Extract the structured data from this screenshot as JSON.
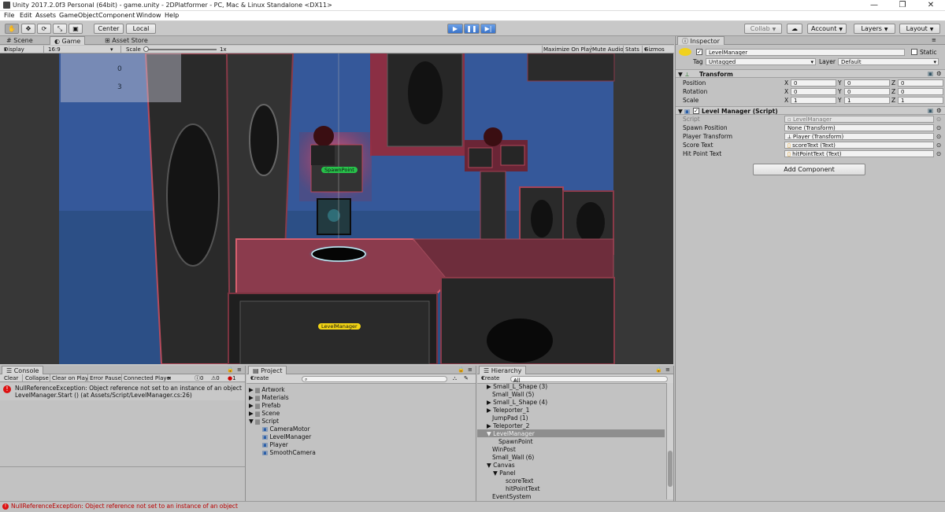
{
  "window": {
    "title": "Unity 2017.2.0f3 Personal (64bit) - game.unity - 2DPlatformer - PC, Mac & Linux Standalone <DX11>",
    "minimize": "—",
    "maximize": "❐",
    "close": "✕"
  },
  "menu": [
    "File",
    "Edit",
    "Assets",
    "GameObject",
    "Component",
    "Window",
    "Help"
  ],
  "toolbar": {
    "tools": [
      "✋",
      "✥",
      "⟳",
      "⤡",
      "▣"
    ],
    "pivot": "Center",
    "space": "Local",
    "play": "▶",
    "pause": "❚❚",
    "step": "▶|",
    "collab": "Collab",
    "account": "Account",
    "layers": "Layers",
    "layout": "Layout"
  },
  "scene_tabs": [
    "Scene",
    "Game",
    "Asset Store"
  ],
  "game_bar": {
    "display": "Display 1",
    "aspect": "16:9",
    "scale_label": "Scale",
    "scale_value": "1x",
    "maximize": "Maximize On Play",
    "mute": "Mute Audio",
    "stats": "Stats",
    "gizmos": "Gizmos"
  },
  "hud": {
    "score": "0",
    "hit_points": "3"
  },
  "scene_labels": {
    "spawn": "SpawnPoint",
    "level": "LevelManager"
  },
  "inspector": {
    "tab": "Inspector",
    "object_name": "LevelManager",
    "static_label": "Static",
    "tag_label": "Tag",
    "tag_value": "Untagged",
    "layer_label": "Layer",
    "layer_value": "Default",
    "transform": {
      "title": "Transform",
      "rows": [
        {
          "label": "Position",
          "x": "0",
          "y": "0",
          "z": "0"
        },
        {
          "label": "Rotation",
          "x": "0",
          "y": "0",
          "z": "0"
        },
        {
          "label": "Scale",
          "x": "1",
          "y": "1",
          "z": "1"
        }
      ]
    },
    "script_comp": {
      "title": "Level Manager (Script)",
      "fields": [
        {
          "label": "Script",
          "value": "LevelManager"
        },
        {
          "label": "Spawn Position",
          "value": "None (Transform)"
        },
        {
          "label": "Player Transform",
          "value": "Player (Transform)"
        },
        {
          "label": "Score Text",
          "value": "scoreText (Text)"
        },
        {
          "label": "Hit Point Text",
          "value": "hitPointText (Text)"
        }
      ]
    },
    "add_component": "Add Component"
  },
  "console": {
    "tab": "Console",
    "buttons": [
      "Clear",
      "Collapse",
      "Clear on Play",
      "Error Pause",
      "Connected Player"
    ],
    "counts": {
      "info": "0",
      "warn": "0",
      "error": "1"
    },
    "error_line1": "NullReferenceException: Object reference not set to an instance of an object",
    "error_line2": "LevelManager.Start () (at Assets/Script/LevelManager.cs:26)"
  },
  "project": {
    "tab": "Project",
    "create": "Create",
    "folders": [
      "Artwork",
      "Materials",
      "Prefab",
      "Scene",
      "Script"
    ],
    "scripts": [
      "CameraMotor",
      "LevelManager",
      "Player",
      "SmoothCamera"
    ]
  },
  "hierarchy": {
    "tab": "Hierarchy",
    "create": "Create",
    "search_placeholder": "All",
    "items": [
      {
        "label": "Small_L_Shape (3)",
        "arrow": "▶"
      },
      {
        "label": "Small_Wall (5)",
        "arrow": ""
      },
      {
        "label": "Small_L_Shape (4)",
        "arrow": "▶"
      },
      {
        "label": "Teleporter_1",
        "arrow": "▶"
      },
      {
        "label": "JumpPad (1)",
        "arrow": ""
      },
      {
        "label": "Teleporter_2",
        "arrow": "▶"
      },
      {
        "label": "LevelManager",
        "arrow": "▼"
      },
      {
        "label": "SpawnPoint",
        "arrow": ""
      },
      {
        "label": "WinPost",
        "arrow": ""
      },
      {
        "label": "Small_Wall (6)",
        "arrow": ""
      },
      {
        "label": "Canvas",
        "arrow": "▼"
      },
      {
        "label": "Panel",
        "arrow": "▼"
      },
      {
        "label": "scoreText",
        "arrow": ""
      },
      {
        "label": "hitPointText",
        "arrow": ""
      },
      {
        "label": "EventSystem",
        "arrow": ""
      }
    ]
  },
  "status": "NullReferenceException: Object reference not set to an instance of an object"
}
